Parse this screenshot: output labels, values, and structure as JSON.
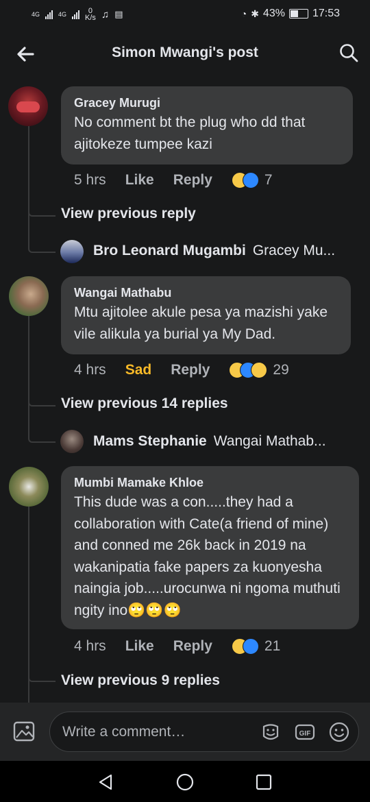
{
  "status_bar": {
    "net1": "4G",
    "net2": "4G",
    "speed_value": "0",
    "speed_unit": "K/s",
    "battery": "43%",
    "time": "17:53"
  },
  "header": {
    "title": "Simon Mwangi's post"
  },
  "comments": [
    {
      "author": "Gracey Murugi",
      "text": "No comment bt the plug who dd that ajitokeze tumpee kazi",
      "time": "5 hrs",
      "reaction_label": "Like",
      "reply_label": "Reply",
      "reactions": [
        "haha-icon",
        "like-icon"
      ],
      "reaction_count": "7",
      "view_replies": "View previous reply",
      "latest_reply": {
        "author": "Bro Leonard Mugambi",
        "text": "Gracey Mu..."
      }
    },
    {
      "author": "Wangai Mathabu",
      "text": "Mtu ajitolee akule pesa ya mazishi yake vile alikula ya burial ya My Dad.",
      "time": "4 hrs",
      "reaction_label": "Sad",
      "reaction_color": "#f7b928",
      "reply_label": "Reply",
      "reactions": [
        "sad-icon",
        "like-icon",
        "wow-icon"
      ],
      "reaction_count": "29",
      "view_replies": "View previous 14 replies",
      "latest_reply": {
        "author": "Mams Stephanie",
        "text": "Wangai Mathab..."
      }
    },
    {
      "author": "Mumbi Mamake Khloe",
      "text": "This dude was a con.....they had a collaboration  with Cate(a friend of mine) and conned me 26k back in 2019 na wakanipatia fake papers za kuonyesha naingia job.....urocunwa ni ngoma muthuti ngity ino🙄🙄🙄",
      "time": "4 hrs",
      "reaction_label": "Like",
      "reply_label": "Reply",
      "reactions": [
        "haha-icon",
        "like-icon"
      ],
      "reaction_count": "21",
      "view_replies": "View previous 9 replies"
    }
  ],
  "composer": {
    "placeholder": "Write a comment…"
  },
  "colors": {
    "background": "#18191a",
    "bubble": "#3a3b3c",
    "sad": "#f7b928",
    "like": "#2d88ff"
  }
}
